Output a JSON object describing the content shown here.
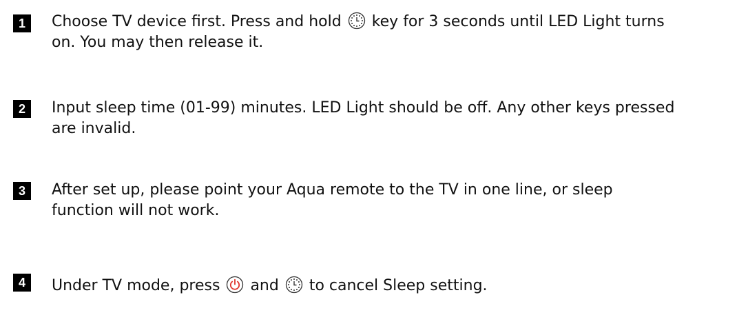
{
  "steps": [
    {
      "number": "1",
      "line1_before": "Choose TV device first. Press and hold",
      "line1_after": "key for 3 seconds until LED Light turns",
      "line2": "on. You may then release it.",
      "icon": "sleep-timer-icon"
    },
    {
      "number": "2",
      "line1": "Input sleep time (01-99) minutes. LED Light should be off. Any other keys pressed",
      "line2": "are invalid."
    },
    {
      "number": "3",
      "line1": "After set up, please point your Aqua remote to the TV in one line, or sleep",
      "line2": "function will not work."
    },
    {
      "number": "4",
      "part1": "Under TV mode, press",
      "part2": "and",
      "part3": "to cancel Sleep setting.",
      "icons": [
        "power-icon",
        "sleep-timer-icon"
      ]
    }
  ],
  "colors": {
    "badge": "#000000",
    "text": "#111111",
    "power_icon": "#e0342c",
    "sleep_icon": "#333333"
  }
}
